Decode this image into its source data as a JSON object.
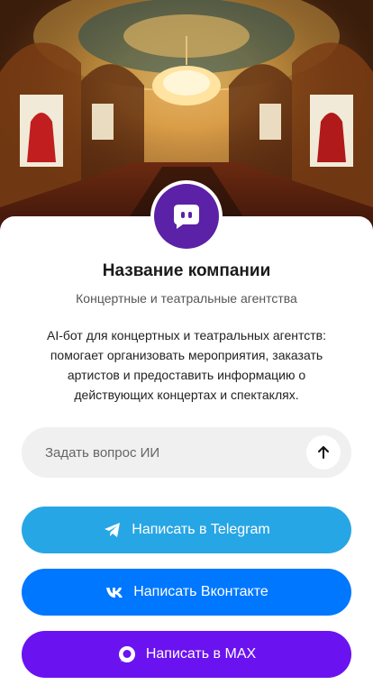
{
  "company": {
    "name": "Название компании",
    "category": "Концертные и театральные агентства",
    "description": "AI-бот для концертных и театральных агентств: помогает организовать мероприятия, заказать артистов и предоставить информацию о действующих концертах и спектаклях."
  },
  "ask": {
    "placeholder": "Задать вопрос ИИ",
    "send_icon": "arrow-up-icon"
  },
  "buttons": {
    "telegram": {
      "label": "Написать в Telegram",
      "icon": "telegram-icon",
      "color": "#27a6e5"
    },
    "vk": {
      "label": "Написать Вконтакте",
      "icon": "vk-icon",
      "color": "#0077ff"
    },
    "max": {
      "label": "Написать в MAX",
      "icon": "max-icon",
      "color": "#6b12f0"
    }
  },
  "colors": {
    "avatar": "#5b21a6"
  }
}
